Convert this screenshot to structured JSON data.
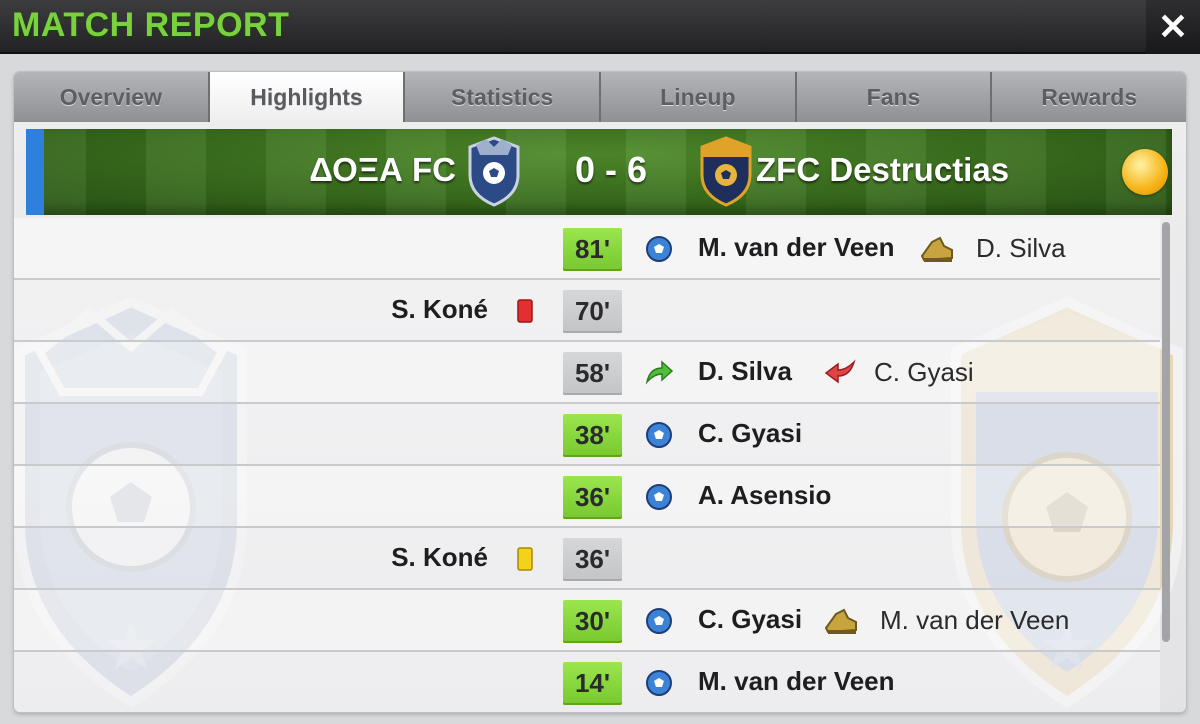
{
  "header": {
    "title": "MATCH REPORT",
    "close_icon": "close-icon"
  },
  "tabs": [
    {
      "label": "Overview",
      "active": false
    },
    {
      "label": "Highlights",
      "active": true
    },
    {
      "label": "Statistics",
      "active": false
    },
    {
      "label": "Lineup",
      "active": false
    },
    {
      "label": "Fans",
      "active": false
    },
    {
      "label": "Rewards",
      "active": false
    }
  ],
  "match": {
    "home_team": "ΔΟΞΑ FC",
    "away_team": "ZFC Destructias",
    "score": "0 - 6",
    "weather_icon": "sun-icon",
    "colors": {
      "home_crest": "#2b4a86",
      "away_crest": "#e0a32a",
      "pitch": "#3a6d1f",
      "goal_minute": "#8bd93f"
    }
  },
  "events": [
    {
      "minute": "81'",
      "type": "goal",
      "side": "away",
      "player": "M. van der Veen",
      "assist": "D. Silva"
    },
    {
      "minute": "70'",
      "type": "red-card",
      "side": "home",
      "player": "S. Koné"
    },
    {
      "minute": "58'",
      "type": "substitution",
      "side": "away",
      "player": "D. Silva",
      "sub_off": "C. Gyasi"
    },
    {
      "minute": "38'",
      "type": "goal",
      "side": "away",
      "player": "C. Gyasi"
    },
    {
      "minute": "36'",
      "type": "goal",
      "side": "away",
      "player": "A. Asensio"
    },
    {
      "minute": "36'",
      "type": "yellow-card",
      "side": "home",
      "player": "S. Koné"
    },
    {
      "minute": "30'",
      "type": "goal",
      "side": "away",
      "player": "C. Gyasi",
      "assist": "M. van der Veen"
    },
    {
      "minute": "14'",
      "type": "goal",
      "side": "away",
      "player": "M. van der Veen"
    }
  ]
}
